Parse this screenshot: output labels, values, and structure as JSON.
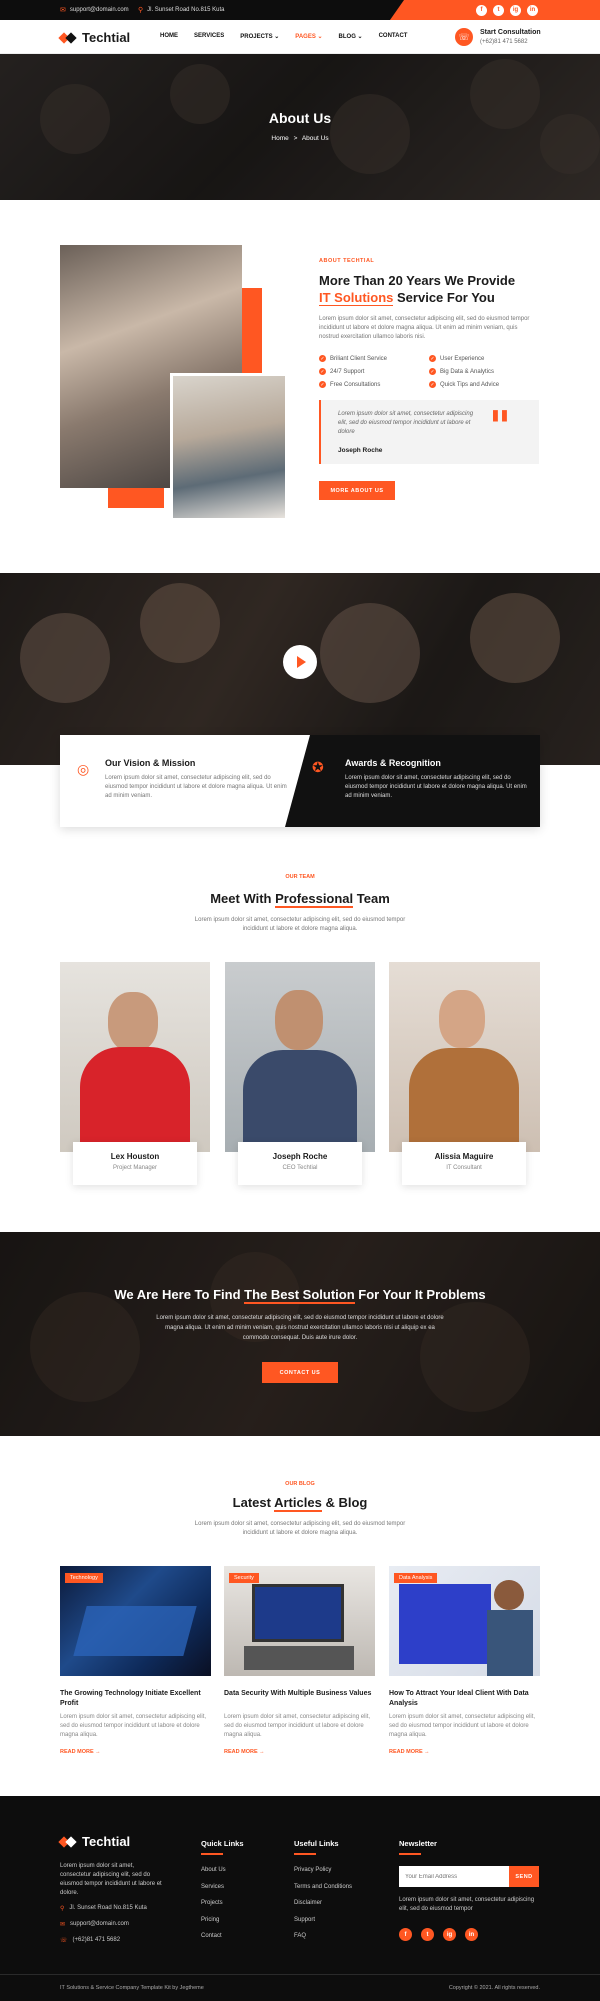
{
  "topbar": {
    "email": "support@domain.com",
    "address": "Jl. Sunset Road No.815 Kuta",
    "social": [
      "f",
      "t",
      "ig",
      "in"
    ]
  },
  "header": {
    "brand": "Techtial",
    "nav": [
      {
        "label": "HOME"
      },
      {
        "label": "SERVICES"
      },
      {
        "label": "PROJECTS ⌄"
      },
      {
        "label": "PAGES ⌄"
      },
      {
        "label": "BLOG ⌄"
      },
      {
        "label": "CONTACT"
      }
    ],
    "consultation_title": "Start Consultation",
    "consultation_phone": "(+62)81 471 5682"
  },
  "hero": {
    "title": "About Us",
    "breadcrumb_home": "Home",
    "breadcrumb_sep": ">",
    "breadcrumb_current": "About Us"
  },
  "about": {
    "eyebrow": "ABOUT TECHTIAL",
    "title_line1": "More Than 20 Years We Provide",
    "title_highlight": "IT Solutions",
    "title_rest": "Service For You",
    "body": "Lorem ipsum dolor sit amet, consectetur adipiscing elit, sed do eiusmod tempor incididunt ut labore et dolore magna aliqua. Ut enim ad minim veniam, quis nostrud exercitation ullamco laboris nisi.",
    "features": [
      "Briliant Client Service",
      "User Experience",
      "24/7 Support",
      "Big Data & Analytics",
      "Free Consultations",
      "Quick Tips and Advice"
    ],
    "quote": "Lorem ipsum dolor sit amet, consectetur adipiscing elit, sed do eiusmod tempor incididunt ut labore et dolore",
    "quote_author": "Joseph Roche",
    "button": "MORE ABOUT US"
  },
  "features_strip": {
    "vision_title": "Our Vision & Mission",
    "vision_body": "Lorem ipsum dolor sit amet, consectetur adipiscing elit, sed do eiusmod tempor incididunt ut labore et dolore magna aliqua. Ut enim ad minim veniam.",
    "awards_title": "Awards & Recognition",
    "awards_body": "Lorem ipsum dolor sit amet, consectetur adipiscing elit, sed do eiusmod tempor incididunt ut labore et dolore magna aliqua. Ut enim ad minim veniam."
  },
  "team": {
    "eyebrow": "OUR TEAM",
    "title_pre": "Meet With",
    "title_highlight": "Professional",
    "title_post": "Team",
    "body": "Lorem ipsum dolor sit amet, consectetur adipiscing elit, sed do eiusmod tempor incididunt ut labore et dolore magna aliqua.",
    "members": [
      {
        "name": "Lex Houston",
        "role": "Project Manager"
      },
      {
        "name": "Joseph Roche",
        "role": "CEO Techtial"
      },
      {
        "name": "Alissia Maguire",
        "role": "IT Consultant"
      }
    ]
  },
  "cta": {
    "title_pre": "We Are Here To Find",
    "title_highlight": "The Best Solution",
    "title_post": "For Your It Problems",
    "body": "Lorem ipsum dolor sit amet, consectetur adipiscing elit, sed do eiusmod tempor incididunt ut labore et dolore magna aliqua. Ut enim ad minim veniam, quis nostrud exercitation ullamco laboris nisi ut aliquip ex ea commodo consequat. Duis aute irure dolor.",
    "button": "CONTACT US"
  },
  "blog": {
    "eyebrow": "OUR BLOG",
    "title_pre": "Latest",
    "title_highlight": "Articles",
    "title_post": "& Blog",
    "body": "Lorem ipsum dolor sit amet, consectetur adipiscing elit, sed do eiusmod tempor incididunt ut labore et dolore magna aliqua.",
    "posts": [
      {
        "tag": "Technology",
        "title": "The Growing Technology Initiate Excellent Profit",
        "excerpt": "Lorem ipsum dolor sit amet, consectetur adipiscing elit, sed do eiusmod tempor incididunt ut labore et dolore magna aliqua.",
        "more": "READ MORE →"
      },
      {
        "tag": "Security",
        "title": "Data Security With Multiple Business Values",
        "excerpt": "Lorem ipsum dolor sit amet, consectetur adipiscing elit, sed do eiusmod tempor incididunt ut labore et dolore magna aliqua.",
        "more": "READ MORE →"
      },
      {
        "tag": "Data Analysis",
        "title": "How To Attract Your Ideal Client With Data Analysis",
        "excerpt": "Lorem ipsum dolor sit amet, consectetur adipiscing elit, sed do eiusmod tempor incididunt ut labore et dolore magna aliqua.",
        "more": "READ MORE →"
      }
    ]
  },
  "footer": {
    "brand": "Techtial",
    "about": "Lorem ipsum dolor sit amet, consectetur adipiscing elit, sed do eiusmod tempor incididunt ut labore et dolore.",
    "address": "Jl. Sunset Road No.815 Kuta",
    "email": "support@domain.com",
    "phone": "(+62)81 471 5682",
    "quick_title": "Quick Links",
    "quick_links": [
      "About Us",
      "Services",
      "Projects",
      "Pricing",
      "Contact"
    ],
    "useful_title": "Useful Links",
    "useful_links": [
      "Privacy Policy",
      "Terms and Conditions",
      "Disclaimer",
      "Support",
      "FAQ"
    ],
    "newsletter_title": "Newsletter",
    "newsletter_placeholder": "Your Email Address",
    "newsletter_button": "SEND",
    "newsletter_body": "Lorem ipsum dolor sit amet, consectetur adipiscing elit, sed do eiusmod tempor",
    "copyright_left": "IT Solutions & Service Company Template Kit by Jegtheme",
    "copyright_right": "Copyright © 2021. All rights reserved."
  },
  "colors": {
    "accent": "#ff5722",
    "dark": "#0d0d0d"
  }
}
